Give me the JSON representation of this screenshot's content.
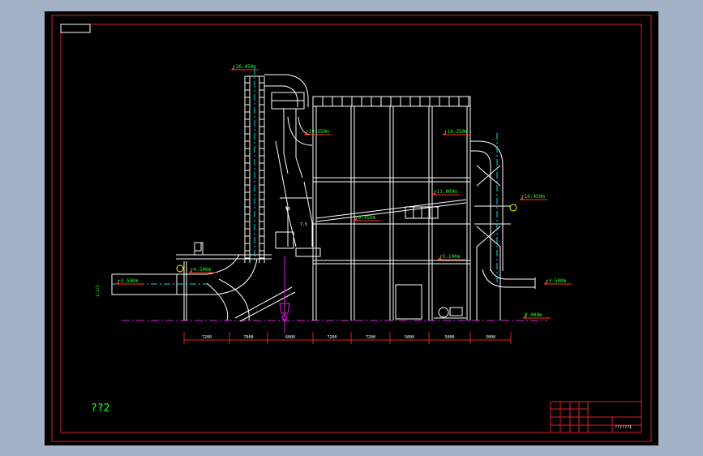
{
  "colors": {
    "background": "#a3b2c6",
    "canvas": "#000000",
    "border": "#e02020",
    "structure": "#ffffff",
    "duct": "#ffffff",
    "centerline": "#00e0e0",
    "ground": "#e020e0",
    "elevation": "#20ff20",
    "elevation_marker": "#ff3030",
    "dimension": "#ff3030",
    "title_block": "#e02020"
  },
  "elevations": {
    "top": "+26.450m",
    "inlet_left": "+19.250m",
    "inlet_right": "+19.250m",
    "right_side": "+10.450m",
    "mid_upper": "+11.000m",
    "mid_lower": "+9.450m",
    "platform_left": "+4.500m",
    "platform_right": "+5.100m",
    "duct_left": "+3.500m",
    "duct_right": "+3.500m",
    "ground": "0.000m"
  },
  "section_tag": "1:1/1",
  "dimension_labels": [
    "7200",
    "7000",
    "6000",
    "7200",
    "7200",
    "5000",
    "5000",
    "3000"
  ],
  "small_labels": {
    "label_a": "99",
    "label_b": "7.5"
  },
  "drawing_note": "??2",
  "title_block": {
    "drawing_number": "??????1"
  }
}
